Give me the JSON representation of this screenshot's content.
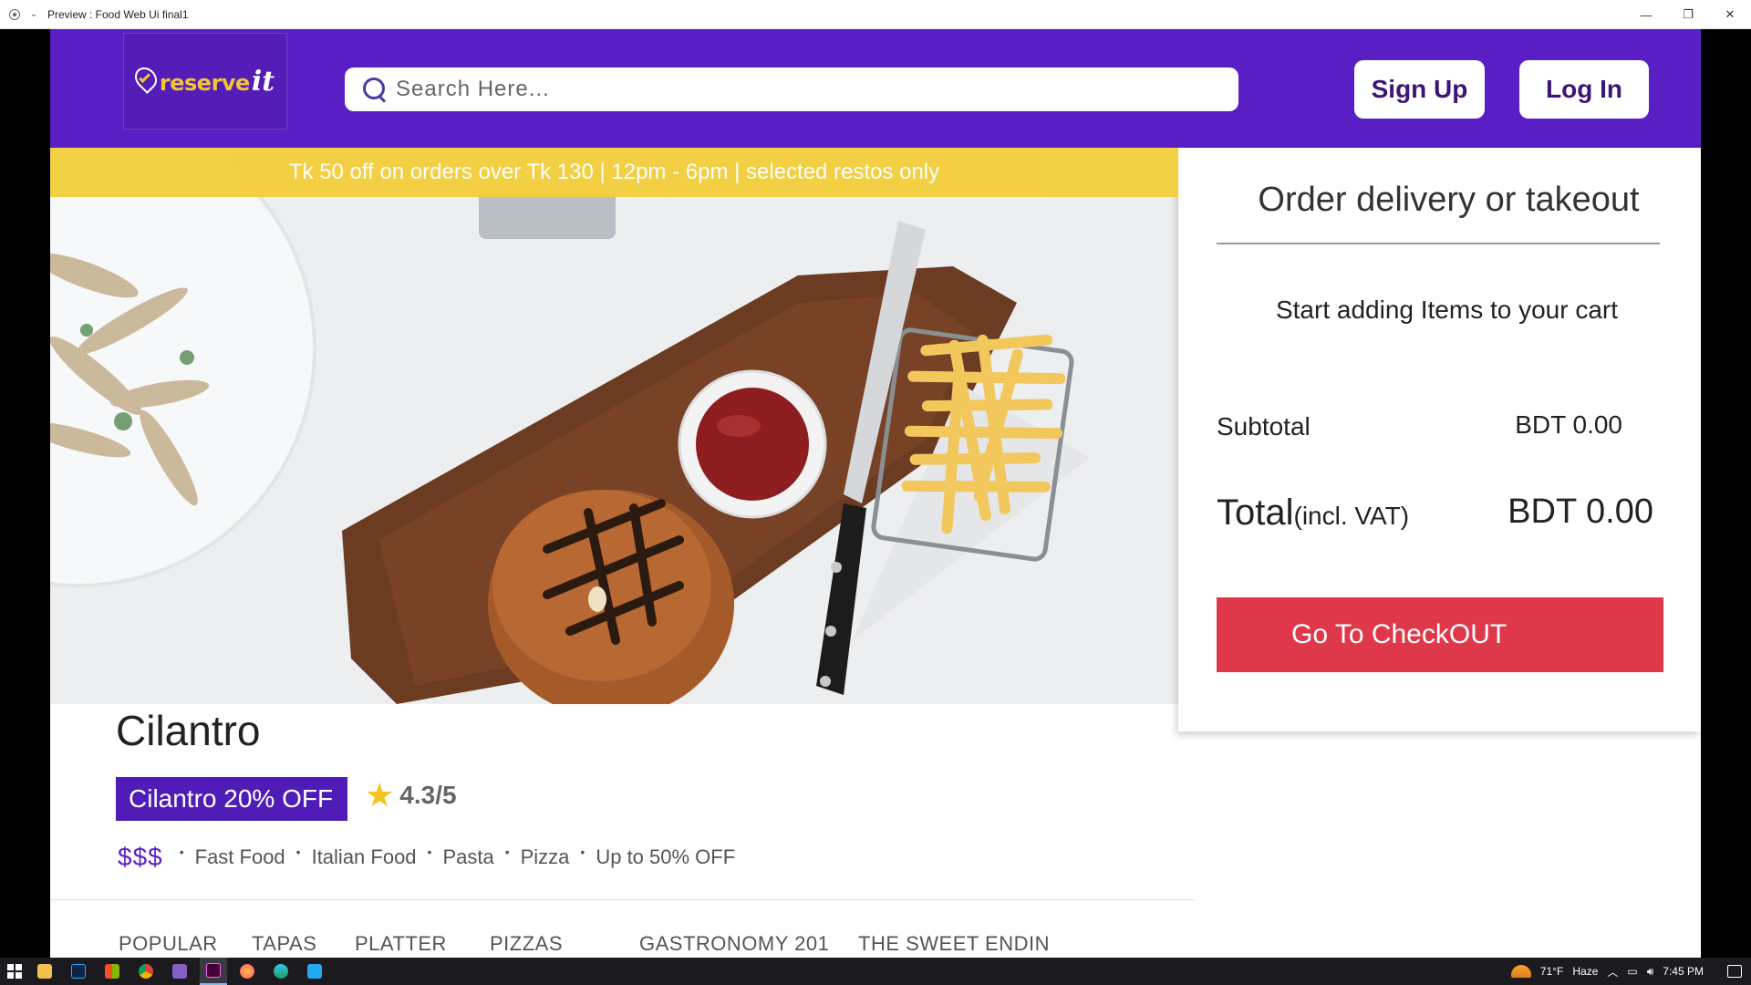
{
  "window": {
    "title": "Preview : Food Web Ui final1",
    "controls": {
      "minimize": "—",
      "restore": "❐",
      "close": "✕"
    }
  },
  "header": {
    "logo": {
      "word": "reserve",
      "suffix": "it"
    },
    "search": {
      "placeholder": "Search Here..."
    },
    "signup_label": "Sign Up",
    "login_label": "Log In",
    "brand_color": "#5a1fc4"
  },
  "promo": {
    "text": "Tk 50 off on orders over Tk 130 | 12pm - 6pm | selected restos only",
    "color": "#f3cf3e"
  },
  "hero": {
    "icon": "burger-and-fries-photo"
  },
  "cart": {
    "title": "Order delivery or takeout",
    "empty_message": "Start adding Items to your cart",
    "subtotal_label": "Subtotal",
    "subtotal_value": "BDT 0.00",
    "total_label": "Total",
    "total_note": "(incl. VAT)",
    "total_value": "BDT 0.00",
    "checkout_label": "Go To CheckOUT",
    "checkout_color": "#e0384b"
  },
  "restaurant": {
    "name": "Cilantro",
    "deal": "Cilantro 20% OFF",
    "rating_score": "4.3",
    "rating_max": "/5",
    "rating_value": 4.3,
    "price_level": "$$$",
    "tags": [
      "Fast Food",
      "Italian Food",
      "Pasta",
      "Pizza",
      "Up to 50% OFF"
    ]
  },
  "menu_tabs": [
    "POPULAR",
    "TAPAS",
    "PLATTER",
    "PIZZAS",
    "GASTRONOMY 201",
    "THE SWEET ENDIN"
  ],
  "taskbar": {
    "apps": [
      "start-icon",
      "file-explorer-icon",
      "photoshop-icon",
      "apps-icon",
      "chrome-icon",
      "visual-studio-icon",
      "adobe-xd-icon",
      "firefox-icon",
      "edge-icon",
      "vscode-icon"
    ],
    "weather": "71°F",
    "weather_label": "Haze",
    "time": "7:45 PM"
  }
}
